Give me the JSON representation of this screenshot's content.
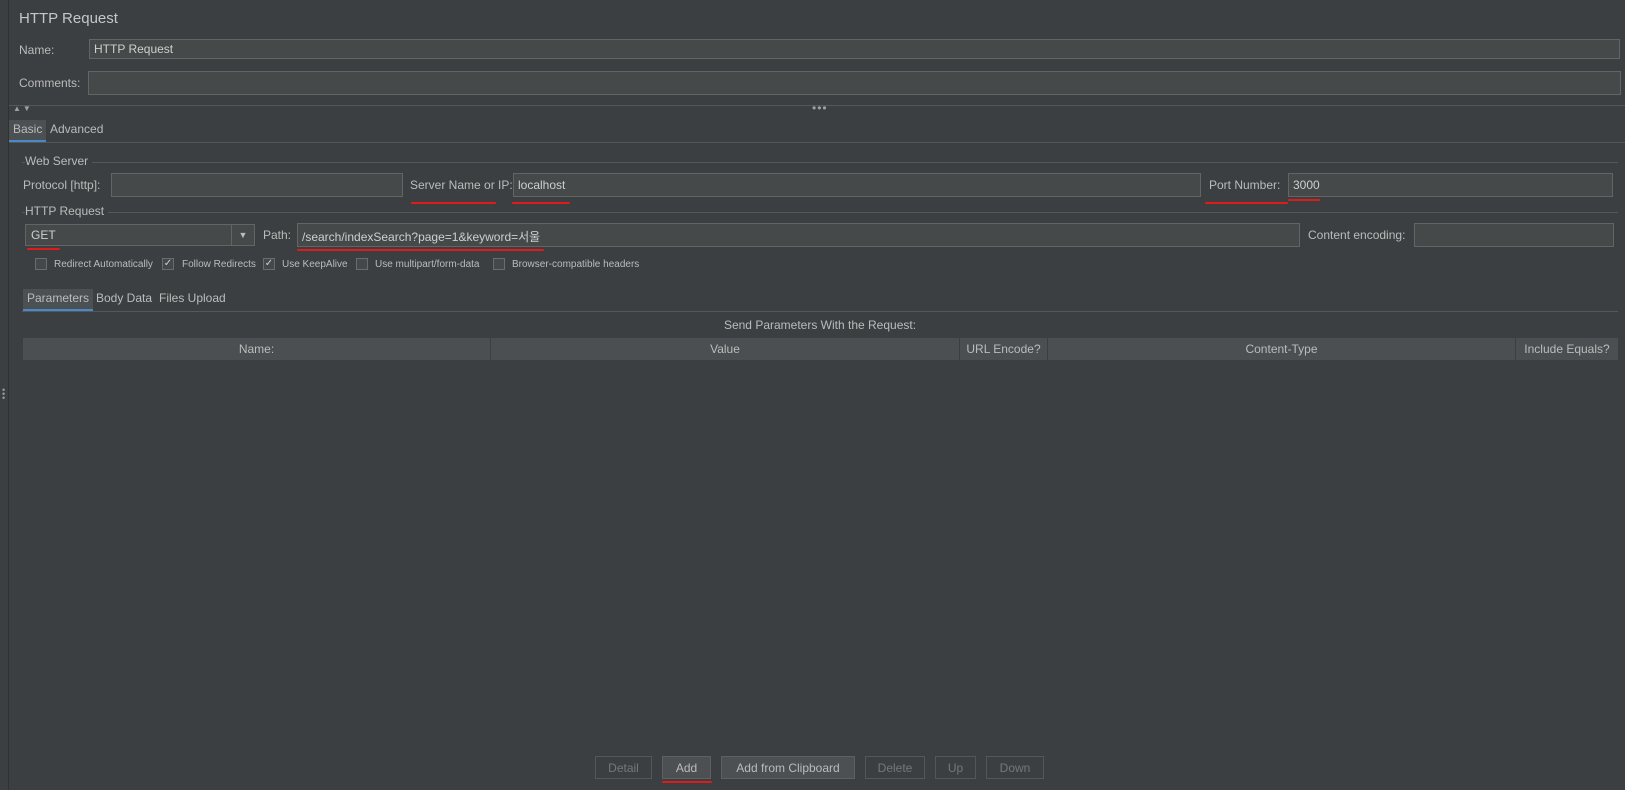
{
  "title": "HTTP Request",
  "name_label": "Name:",
  "name_value": "HTTP Request",
  "comments_label": "Comments:",
  "comments_value": "",
  "tabs": [
    {
      "label": "Basic"
    },
    {
      "label": "Advanced"
    }
  ],
  "web_server": {
    "group_title": "Web Server",
    "protocol_label": "Protocol [http]:",
    "protocol_value": "",
    "server_label": "Server Name or IP:",
    "server_value": "localhost",
    "port_label": "Port Number:",
    "port_value": "3000"
  },
  "http_request": {
    "group_title": "HTTP Request",
    "method": "GET",
    "path_label": "Path:",
    "path_value": "/search/indexSearch?page=1&keyword=서울",
    "encoding_label": "Content encoding:",
    "encoding_value": ""
  },
  "checkboxes": [
    {
      "label": "Redirect Automatically",
      "checked": false
    },
    {
      "label": "Follow Redirects",
      "checked": true
    },
    {
      "label": "Use KeepAlive",
      "checked": true
    },
    {
      "label": "Use multipart/form-data",
      "checked": false
    },
    {
      "label": "Browser-compatible headers",
      "checked": false
    }
  ],
  "sub_tabs": [
    {
      "label": "Parameters"
    },
    {
      "label": "Body Data"
    },
    {
      "label": "Files Upload"
    }
  ],
  "params_caption": "Send Parameters With the Request:",
  "table_headers": [
    "Name:",
    "Value",
    "URL Encode?",
    "Content-Type",
    "Include Equals?"
  ],
  "buttons": [
    {
      "label": "Detail",
      "enabled": false
    },
    {
      "label": "Add",
      "enabled": true
    },
    {
      "label": "Add from Clipboard",
      "enabled": true
    },
    {
      "label": "Delete",
      "enabled": false
    },
    {
      "label": "Up",
      "enabled": false
    },
    {
      "label": "Down",
      "enabled": false
    }
  ],
  "colors": {
    "background": "#3c3f41",
    "field": "#45494a",
    "accent": "#4a88c7",
    "annotation": "#e01b1b"
  }
}
